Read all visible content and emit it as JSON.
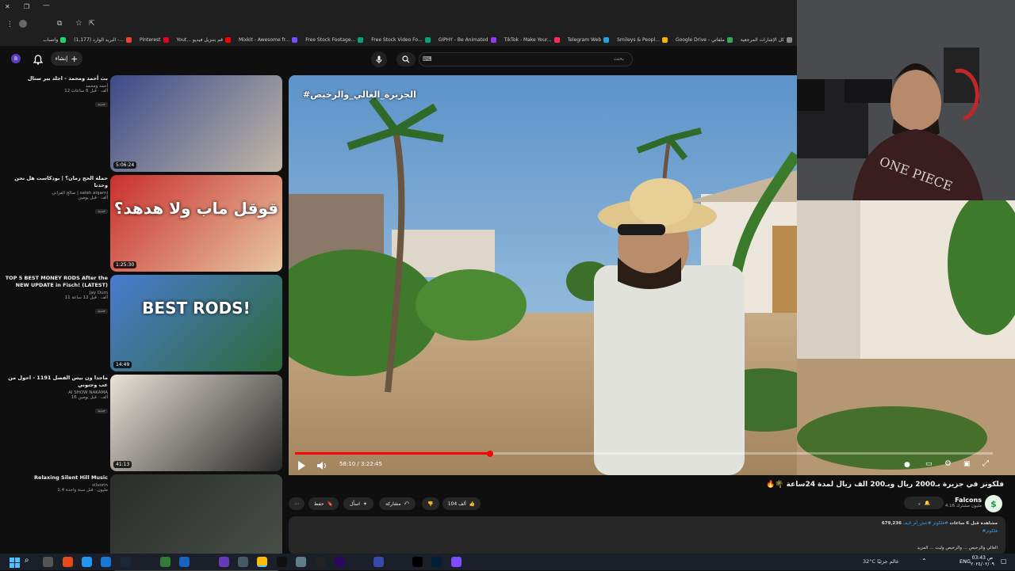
{
  "browser": {
    "bookmarks": [
      {
        "label": "كل الإشارات المرجعية",
        "color": "#888"
      },
      {
        "label": "Google Drive - ملفاتي",
        "color": "#34a853"
      },
      {
        "label": "Smileys & Peopl...",
        "color": "#f4b400"
      },
      {
        "label": "Telegram Web",
        "color": "#2aa1da"
      },
      {
        "label": "TikTok - Make Your...",
        "color": "#fe2c55"
      },
      {
        "label": "GIPHY - Be Animated",
        "color": "#9933ff"
      },
      {
        "label": "Free Stock Video Fo...",
        "color": "#05a081"
      },
      {
        "label": "Free Stock Footage...",
        "color": "#05a081"
      },
      {
        "label": "Mixkit - Awesome fr...",
        "color": "#7b4dff"
      },
      {
        "label": "Yout... قم بتنزيل فيديو",
        "color": "#ff0000"
      },
      {
        "label": "Pinterest",
        "color": "#e60023"
      },
      {
        "label": "(1,177) البريد الوارد -...",
        "color": "#ea4335"
      },
      {
        "label": "واتساب",
        "color": "#25d366"
      }
    ]
  },
  "header": {
    "search_placeholder": "بحث",
    "search_value": "⌨",
    "create_label": "إنشاء",
    "avatar_letter": "B"
  },
  "recommendations": [
    {
      "title": "بث أحمد ومحمد - اجلد يبر ستال",
      "channel": "أحمد ومحمد",
      "views": "12 ألف · قبل 6 ساعات",
      "badge": "جديد",
      "duration": "5:06:24",
      "thumb_colors": [
        "#3a4a8a",
        "#c2b8a8"
      ]
    },
    {
      "title": "حملة الحج زمان؟ | بودكاست هل نحن وحدنا",
      "channel": "صالح الفزاني | saleh alqarni",
      "views": "ألف · قبل يومين",
      "badge": "جديد",
      "duration": "1:25:30",
      "thumb_colors": [
        "#c9302c",
        "#e7c7a3"
      ],
      "thumb_text": "قوقل ماب ولا هدهد؟"
    },
    {
      "title": "TOP 5 BEST MONEY RODS After the NEW UPDATE in Fisch! (LATEST)",
      "channel": "Jay Dum",
      "views": "11 ألف · قبل 12 ساعة",
      "badge": "جديد",
      "duration": "14:49",
      "thumb_colors": [
        "#4a7bd0",
        "#2c6a3a"
      ],
      "thumb_text": "BEST RODS!"
    },
    {
      "title": "ماجدا ون بيس الفصل 1191 - احول من عب وجنوني",
      "channel": "Al SHOW NAKAMA",
      "views": "16 ألف · قبل يومين",
      "badge": "جديد",
      "duration": "41:13",
      "thumb_colors": [
        "#e8e2d6",
        "#2b2b2b"
      ]
    },
    {
      "title": "Relaxing Silent Hill Music",
      "channel": "silvorin",
      "views": "1.4 مليون · قبل سنة واحدة",
      "badge": "",
      "duration": "",
      "thumb_colors": [
        "#2a2d2a",
        "#4a4f48"
      ]
    }
  ],
  "player": {
    "overlay_text": "#الجزيرة_الغالي_والرخيص",
    "time": "58:10 / 3:22:45",
    "progress": 0.28
  },
  "video": {
    "title": "فلكونز في جزيرة بـ2000 ريال وبـ200 الف ريال لمدة 24ساعة 🌴🔥",
    "channel": "Falcons",
    "subscribers": "4.16 مليون مشترك",
    "likes": "104 ألف",
    "share": "مشاركة",
    "ask": "اسأل",
    "save": "حفظ",
    "views": "679,236 مشاهدة قبل 6 ساعات",
    "tags": "#فلكونز #عش_أم_لايف",
    "hashtag": "#فلكونز",
    "desc": "الغالي والرخيص ... والرخيص وليث ... المزيد"
  },
  "taskbar": {
    "weather": "32°C عالم جزئيًا",
    "lang": "ENG",
    "time": "03:43 ص",
    "date": "٢٠٢٤/٠٢/٠٩"
  },
  "colors": {
    "accent": "#ff0000",
    "bg": "#0f0f0f",
    "chip": "#272727"
  }
}
